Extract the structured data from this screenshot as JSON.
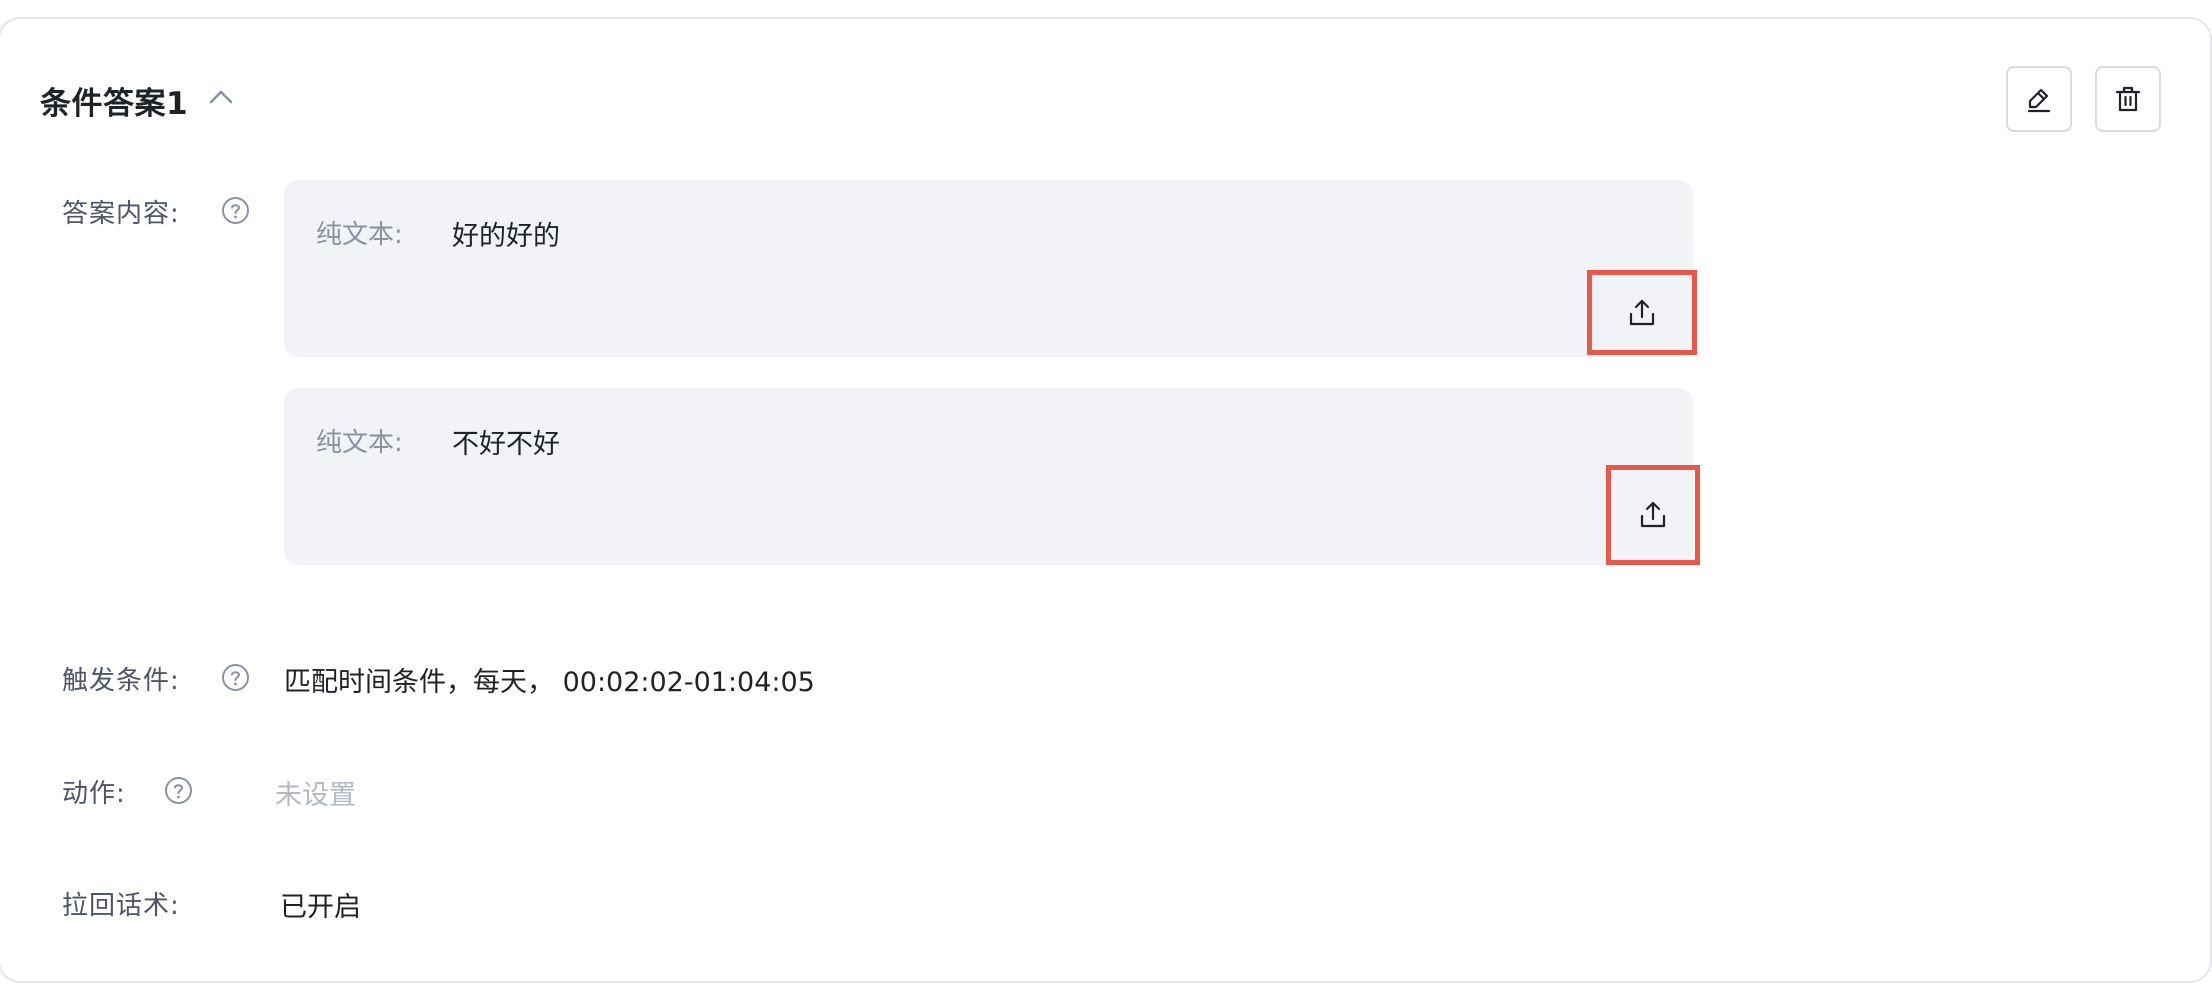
{
  "card": {
    "title": "条件答案1",
    "collapse_icon": "chevron-up-icon",
    "edit_icon": "pencil-icon",
    "delete_icon": "trash-icon"
  },
  "answer_content": {
    "label": "答案内容:",
    "items": [
      {
        "type_label": "纯文本:",
        "text": "好的好的",
        "action_icon": "upload-icon"
      },
      {
        "type_label": "纯文本:",
        "text": "不好不好",
        "action_icon": "upload-icon"
      }
    ]
  },
  "trigger": {
    "label": "触发条件:",
    "value": "匹配时间条件，每天， 00:02:02-01:04:05"
  },
  "action": {
    "label": "动作:",
    "value": "未设置"
  },
  "pullback": {
    "label": "拉回话术:",
    "value": "已开启"
  },
  "colors": {
    "highlight_border": "#e8584a",
    "answer_bg": "#f2f3f7",
    "muted_text": "#b3b8c4"
  }
}
